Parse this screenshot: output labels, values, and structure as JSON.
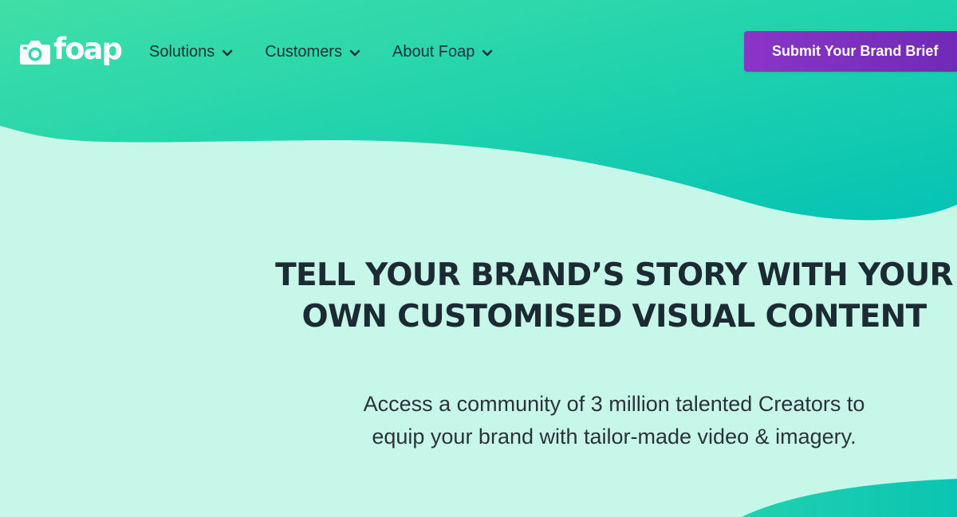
{
  "header": {
    "logo_text": "foap",
    "logo_icon": "camera-icon",
    "nav": [
      {
        "label": "Solutions",
        "icon": "chevron-down-icon"
      },
      {
        "label": "Customers",
        "icon": "chevron-down-icon"
      },
      {
        "label": "About Foap",
        "icon": "chevron-down-icon"
      }
    ],
    "cta_label": "Submit Your Brand Brief"
  },
  "hero": {
    "headline_line1": "TELL YOUR BRAND’S STORY WITH YOUR",
    "headline_line2": "OWN CUSTOMISED VISUAL CONTENT",
    "subtext_line1": "Access a community of 3 million talented Creators to",
    "subtext_line2": "equip your brand with tailor-made video & imagery."
  },
  "colors": {
    "header_gradient_top": "#3ddfa8",
    "header_gradient_bottom": "#0cc7b2",
    "hero_background": "#c6f7e9",
    "cta_background": "#7b2fbe",
    "text_dark": "#1c2b33"
  }
}
